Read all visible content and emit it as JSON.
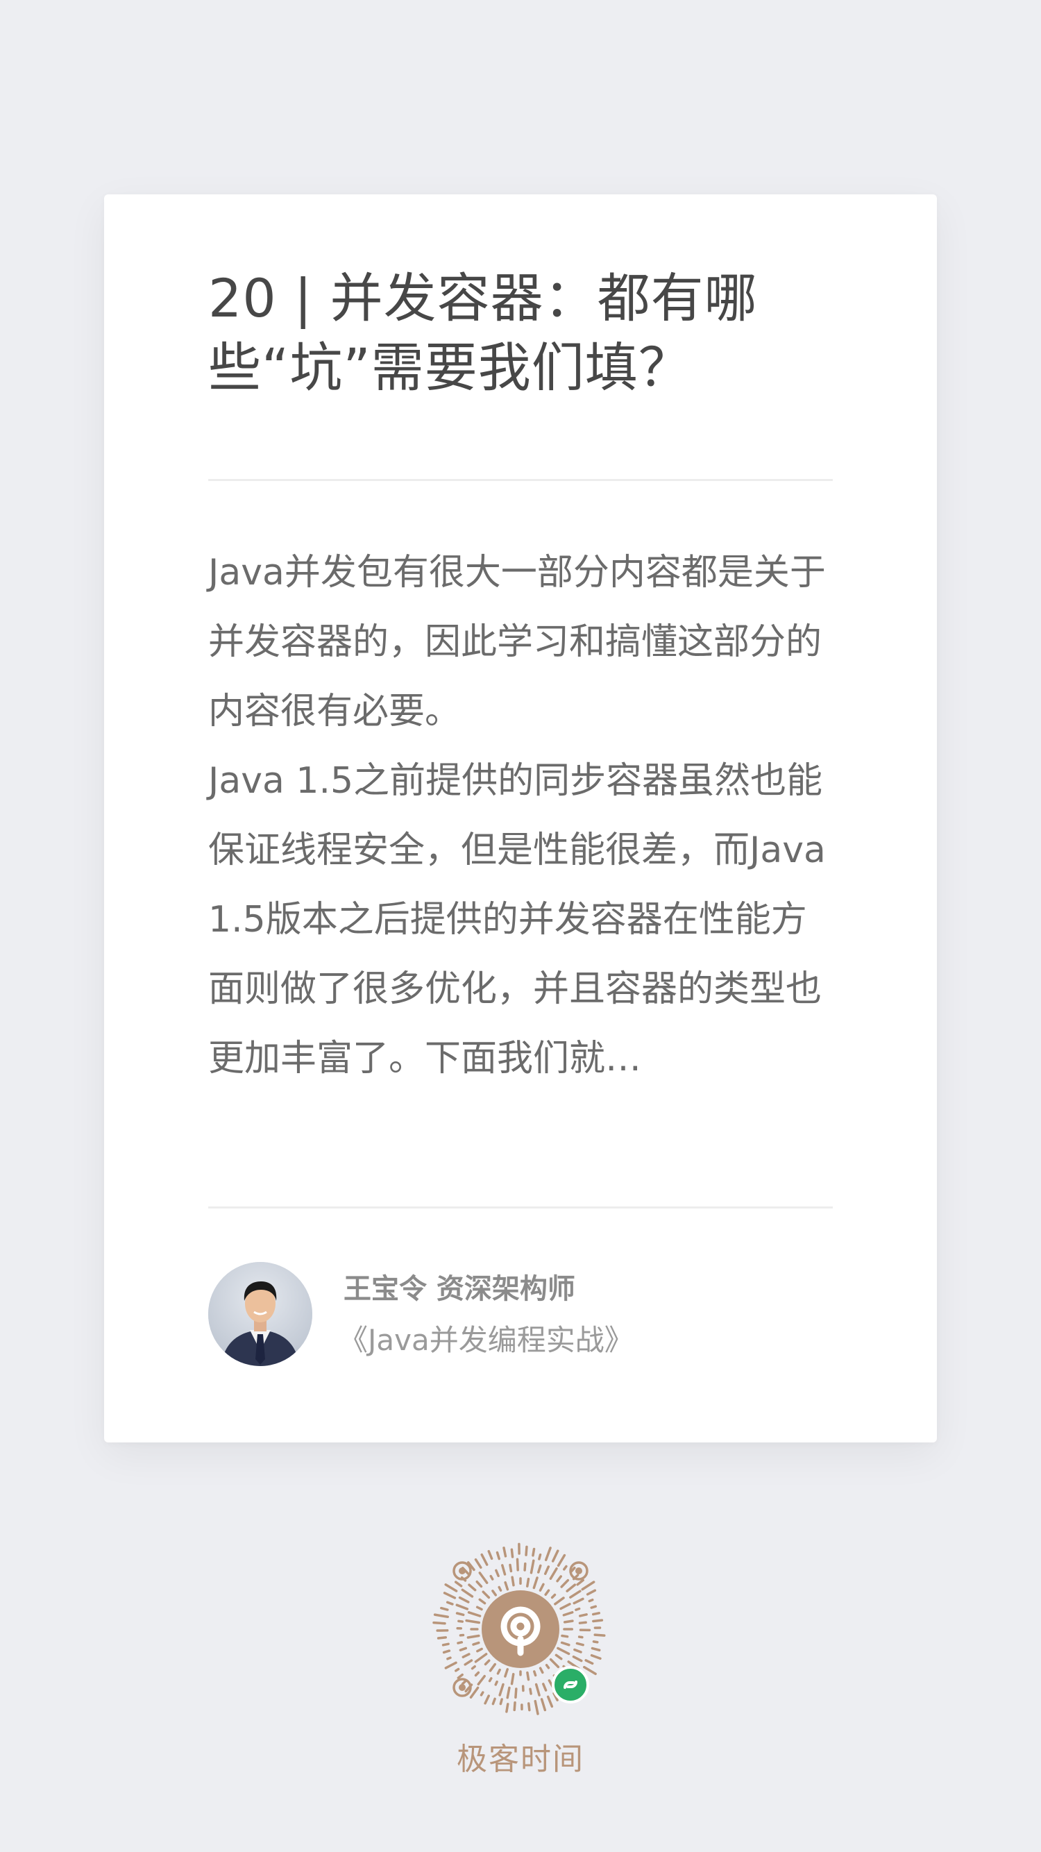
{
  "card": {
    "title": "20 | 并发容器：都有哪些“坑”需要我们填？",
    "intro": "Java并发包有很大一部分内容都是关于并发容器的，因此学习和搞懂这部分的内容很有必要。\nJava 1.5之前提供的同步容器虽然也能保证线程安全，但是性能很差，而Java 1.5版本之后提供的并发容器在性能方面则做了很多优化，并且容器的类型也更加丰富了。下面我们就…",
    "author": {
      "name_title": "王宝令 资深架构师",
      "course": "《Java并发编程实战》"
    }
  },
  "footer": {
    "brand": "极客时间"
  },
  "colors": {
    "background": "#edeef2",
    "card": "#ffffff",
    "title_text": "#474747",
    "body_text": "#6b6b6b",
    "brand": "#b8957a",
    "wechat_badge": "#2aae67"
  }
}
